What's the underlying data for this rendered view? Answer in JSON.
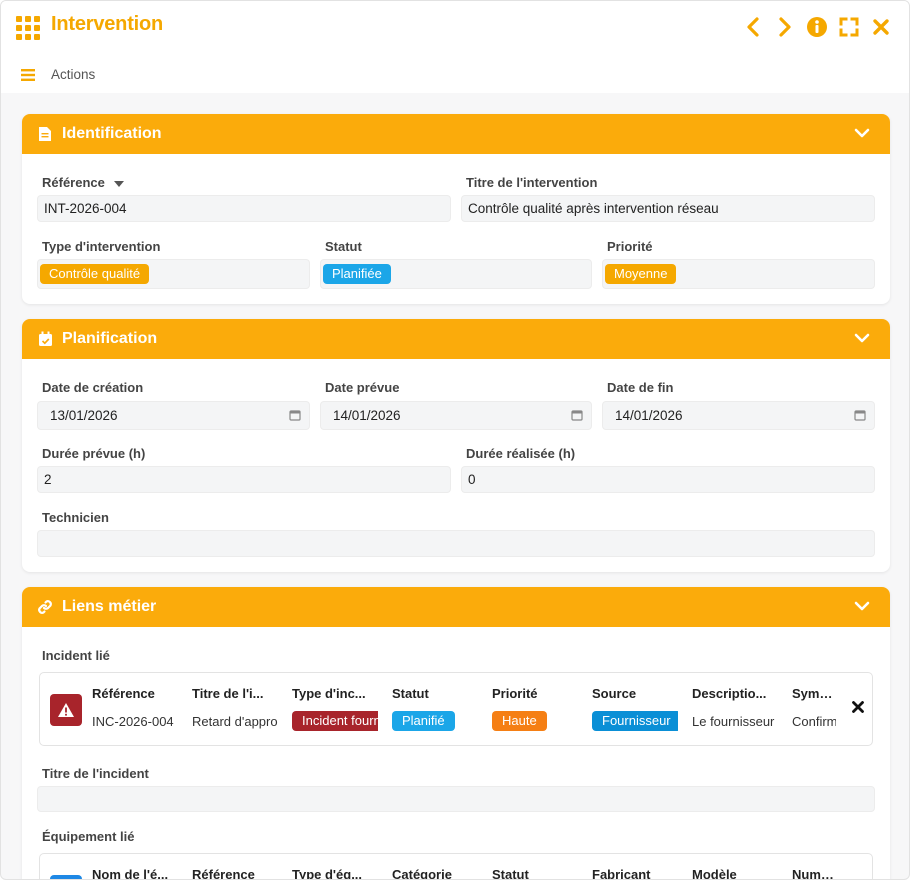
{
  "window": {
    "title": "Intervention",
    "accent": "#f5a800",
    "controls": [
      "chevron-left-icon",
      "chevron-right-icon",
      "info-icon",
      "fullscreen-icon",
      "close-icon"
    ]
  },
  "toolbar": {
    "menu_icon": "hamburger-icon",
    "actions_label": "Actions"
  },
  "identification": {
    "title": "Identification",
    "reference_label": "Référence",
    "reference_value": "INT-2026-004",
    "titre_label": "Titre de l'intervention",
    "titre_value": "Contrôle qualité après intervention réseau",
    "type_label": "Type d'intervention",
    "type_value": "Contrôle qualité",
    "statut_label": "Statut",
    "statut_value": "Planifiée",
    "priorite_label": "Priorité",
    "priorite_value": "Moyenne"
  },
  "planification": {
    "title": "Planification",
    "date_creation_label": "Date de création",
    "date_creation_value": "13/01/2026",
    "date_prevue_label": "Date prévue",
    "date_prevue_value": "14/01/2026",
    "date_fin_label": "Date de fin",
    "date_fin_value": "14/01/2026",
    "duree_prevue_label": "Durée prévue (h)",
    "duree_prevue_value": "2",
    "duree_realisee_label": "Durée réalisée (h)",
    "duree_realisee_value": "0",
    "technicien_label": "Technicien",
    "technicien_value": ""
  },
  "liens": {
    "title": "Liens métier",
    "incident_label": "Incident lié",
    "incident": {
      "headers": [
        "Référence",
        "Titre de l'i...",
        "Type d'inc...",
        "Statut",
        "Priorité",
        "Source",
        "Descriptio...",
        "Sympto"
      ],
      "reference": "INC-2026-004",
      "titre": "Retard d'appro",
      "type": "Incident fourn",
      "statut": "Planifié",
      "priorite": "Haute",
      "source": "Fournisseur",
      "description": "Le fournisseur",
      "symptome": "Confirm"
    },
    "titre_incident_label": "Titre de l'incident",
    "titre_incident_value": "",
    "equipement_label": "Équipement lié",
    "equipement_headers": [
      "Nom de l'é...",
      "Référence",
      "Type d'éq...",
      "Catégorie",
      "Statut",
      "Fabricant",
      "Modèle",
      "Numéro"
    ]
  },
  "colors": {
    "orange": "#f5a800",
    "blue": "#1ba6e8",
    "red": "#a8242b",
    "dark_orange": "#f57f14",
    "source_blue": "#0a8fd6",
    "equip_blue": "#1e88e5"
  }
}
